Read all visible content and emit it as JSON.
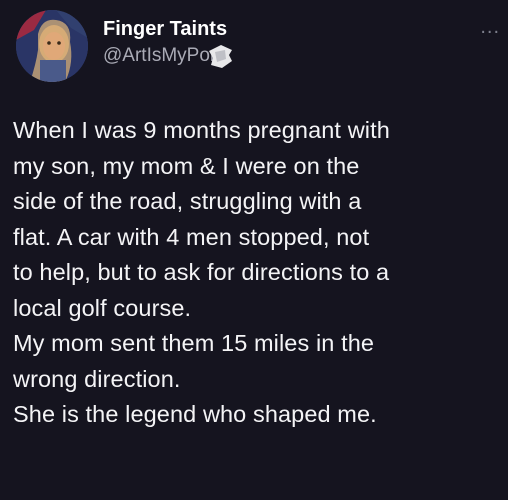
{
  "author": {
    "display_name": "Finger Taints",
    "handle": "@ArtIsMyPorn",
    "avatar_icon": "profile-photo"
  },
  "more_menu": {
    "label": "...",
    "icon": "more-options-icon"
  },
  "tweet": {
    "lines": [
      "When I was 9 months pregnant with",
      "my son, my mom & I were on the",
      "side of the road, struggling with a",
      "flat. A car with 4 men stopped, not",
      "to help, but to ask for directions to a",
      "local golf course.",
      "My mom sent them 15 miles in the",
      "wrong direction.",
      "She is the legend who shaped me."
    ]
  },
  "colors": {
    "background": "#15141f",
    "text": "#f4f4f6",
    "secondary_text": "#a9aab5"
  }
}
